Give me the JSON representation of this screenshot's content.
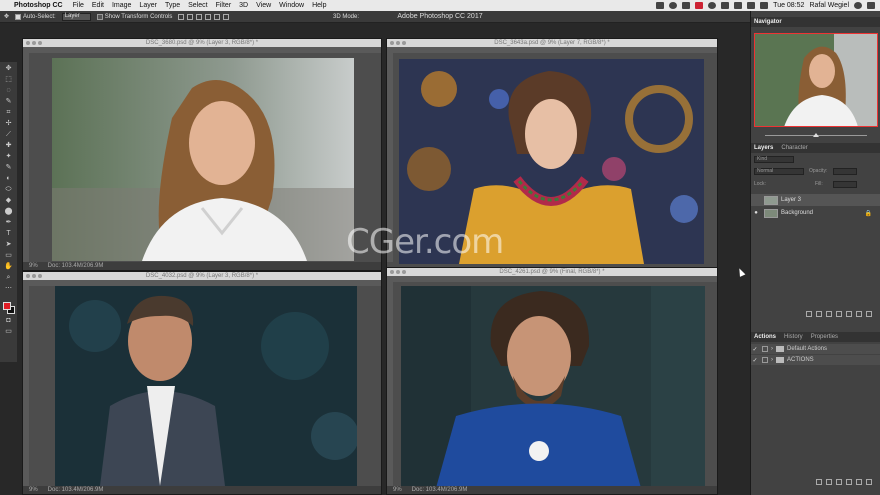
{
  "menubar": {
    "apple_glyph": "",
    "app_name": "Photoshop CC",
    "items": [
      "File",
      "Edit",
      "Image",
      "Layer",
      "Type",
      "Select",
      "Filter",
      "3D",
      "View",
      "Window",
      "Help"
    ],
    "clock": "Tue 08:52",
    "user": "Rafal Wegiel"
  },
  "options": {
    "move_glyph": "✥",
    "auto_select_label": "Auto-Select:",
    "auto_select_value": "Layer",
    "show_transform_label": "Show Transform Controls",
    "mode_label": "3D Mode:",
    "window_title": "Adobe Photoshop CC 2017"
  },
  "toolbar": {
    "glyphs": [
      "✥",
      "⬚",
      "◌",
      "✎",
      "⌗",
      "✢",
      "⟋",
      "✚",
      "✦",
      "✎",
      "◐",
      "⬭",
      "◆",
      "⬤",
      "✒",
      "T",
      "➤",
      "▭",
      "✋",
      "⌕",
      "⋯"
    ],
    "fg_color": "#e01b24",
    "bg_color": "#111111"
  },
  "docs": [
    {
      "title": "DSC_3680.psd @ 9% (Layer 3, RGB/8*) *",
      "zoom": "9%",
      "info": "Doc: 103.4M/206.9M"
    },
    {
      "title": "DSC_3643a.psd @ 9% (Layer 7, RGB/8*) *",
      "zoom": "",
      "info": ""
    },
    {
      "title": "DSC_4032.psd @ 9% (Layer 3, RGB/8*) *",
      "zoom": "9%",
      "info": "Doc: 103.4M/206.9M"
    },
    {
      "title": "DSC_4261.psd @ 9% (Final, RGB/8*) *",
      "zoom": "9%",
      "info": "Doc: 103.4M/206.9M"
    }
  ],
  "panels": {
    "navigator_tab": "Navigator",
    "layers_tab": "Layers",
    "character_tab": "Character",
    "kind_label": "Kind",
    "normal_label": "Normal",
    "opacity_label": "Opacity:",
    "lock_label": "Lock:",
    "fill_label": "Fill:",
    "layers": [
      {
        "name": "Layer 3",
        "selected": true,
        "visible": false
      },
      {
        "name": "Background",
        "selected": false,
        "visible": true
      }
    ],
    "actions_tab": "Actions",
    "history_tab": "History",
    "properties_tab": "Properties",
    "actions": [
      "Default Actions",
      "ACTIONS"
    ],
    "eye_glyph": "●",
    "check_glyph": "✓",
    "chevron_glyph": "›",
    "lock_glyph": "🔒"
  },
  "watermark": "CGer.com",
  "colors": {
    "accent_red": "#e33333",
    "panel_bg": "#424242",
    "workspace_bg": "#282828"
  }
}
